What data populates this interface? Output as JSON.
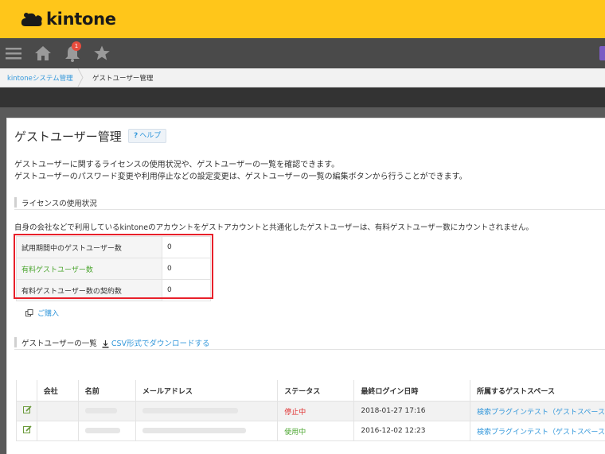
{
  "app": {
    "logo_text": "kintone"
  },
  "navbar": {
    "notification_count": "1"
  },
  "breadcrumb": {
    "items": [
      "kintoneシステム管理",
      "ゲストユーザー管理"
    ]
  },
  "page": {
    "title": "ゲストユーザー管理",
    "help_icon": "?",
    "help_label": "ヘルプ",
    "desc1": "ゲストユーザーに関するライセンスの使用状況や、ゲストユーザーの一覧を確認できます。",
    "desc2": "ゲストユーザーのパスワード変更や利用停止などの設定変更は、ゲストユーザーの一覧の編集ボタンから行うことができます。"
  },
  "license": {
    "section_title": "ライセンスの使用状況",
    "note": "自身の会社などで利用しているkintoneのアカウントをゲストアカウントと共通化したゲストユーザーは、有料ゲストユーザー数にカウントされません。",
    "rows": [
      {
        "label": "試用期間中のゲストユーザー数",
        "value": "0"
      },
      {
        "label": "有料ゲストユーザー数",
        "value": "0"
      },
      {
        "label": "有料ゲストユーザー数の契約数",
        "value": "0"
      }
    ],
    "purchase_label": "ご購入"
  },
  "users": {
    "section_title": "ゲストユーザーの一覧",
    "csv_label": "CSV形式でダウンロードする",
    "columns": [
      "",
      "会社",
      "名前",
      "メールアドレス",
      "ステータス",
      "最終ログイン日時",
      "所属するゲストスペース"
    ],
    "rows": [
      {
        "status": "停止中",
        "last_login": "2018-01-27 17:16",
        "space": "検索プラグインテスト（ゲストスペース"
      },
      {
        "status": "使用中",
        "last_login": "2016-12-02 12:23",
        "space": "検索プラグインテスト（ゲストスペース"
      }
    ]
  },
  "colors": {
    "header": "#ffc61a",
    "navbar": "#4a4a4a",
    "link": "#3498db",
    "highlight_box": "#e8202a",
    "green": "#4aa52e",
    "red": "#e02b2b"
  }
}
